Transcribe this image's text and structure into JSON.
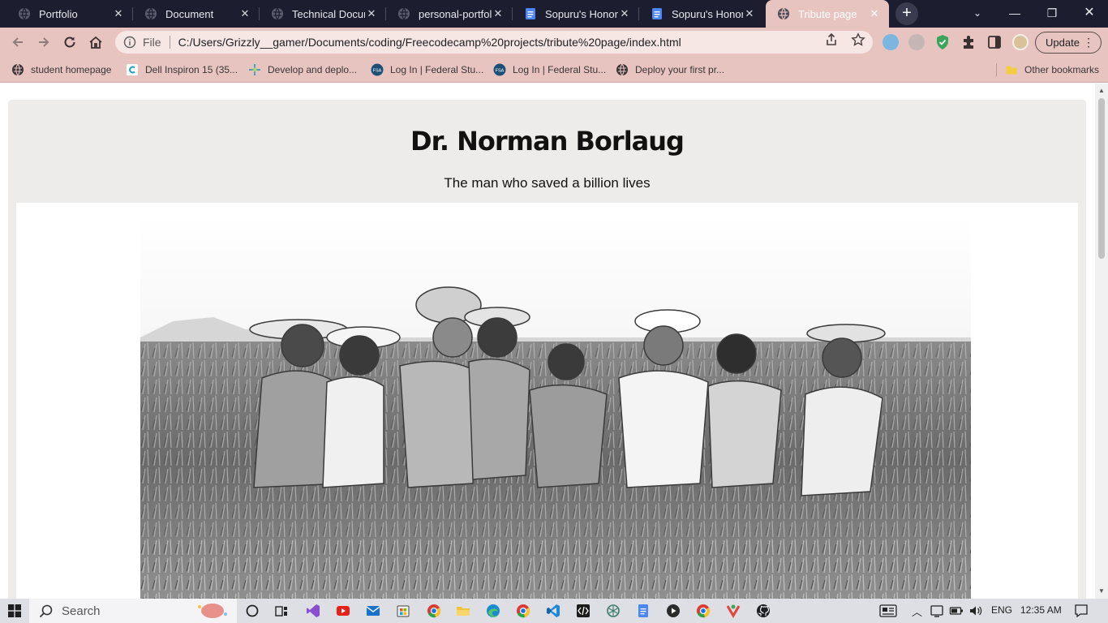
{
  "browser": {
    "tabs": [
      {
        "label": "Portfolio",
        "icon": "globe-icon"
      },
      {
        "label": "Document",
        "icon": "globe-icon"
      },
      {
        "label": "Technical Documen",
        "icon": "globe-icon"
      },
      {
        "label": "personal-portfolio",
        "icon": "globe-icon"
      },
      {
        "label": "Sopuru's Honors",
        "icon": "google-docs-icon"
      },
      {
        "label": "Sopuru's Honors",
        "icon": "google-docs-icon"
      },
      {
        "label": "Tribute page",
        "icon": "globe-icon"
      }
    ],
    "active_tab_index": 6,
    "address": {
      "scheme_label": "File",
      "url": "C:/Users/Grizzly__gamer/Documents/coding/Freecodecamp%20projects/tribute%20page/index.html"
    },
    "update_label": "Update",
    "bookmarks": [
      {
        "label": "student homepage"
      },
      {
        "label": "Dell Inspiron 15 (35..."
      },
      {
        "label": "Develop and deplo..."
      },
      {
        "label": "Log In | Federal Stu..."
      },
      {
        "label": "Log In | Federal Stu..."
      },
      {
        "label": "Deploy your first pr..."
      }
    ],
    "other_bookmarks": "Other bookmarks"
  },
  "page": {
    "title": "Dr. Norman Borlaug",
    "subtitle": "The man who saved a billion lives"
  },
  "taskbar": {
    "search_placeholder": "Search",
    "language": "ENG",
    "time": "12:35 AM"
  },
  "colors": {
    "tab_strip": "#1c1d2e",
    "chrome_theme": "#e8c4c1",
    "page_panel": "#eeecea"
  }
}
